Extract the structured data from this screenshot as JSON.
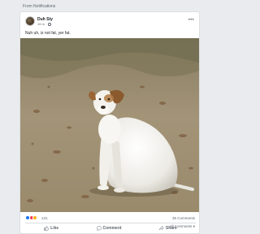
{
  "section": {
    "title": "From Notifications"
  },
  "post": {
    "author": "Duh Sty",
    "time": "15 m",
    "text": "Nuh uh, iz not fat, yer fat.",
    "photo_description": "white dog with brown ear sitting on dirt ground"
  },
  "stats": {
    "reaction_count": "131",
    "comments": "35 Comments"
  },
  "actions": {
    "like": "Like",
    "comment": "Comment",
    "share": "Share"
  },
  "comments_filter": "All Comments ▾",
  "colors": {
    "like_blue": "#1877f2",
    "love_red": "#f33e58",
    "haha_yellow": "#f7b125"
  }
}
